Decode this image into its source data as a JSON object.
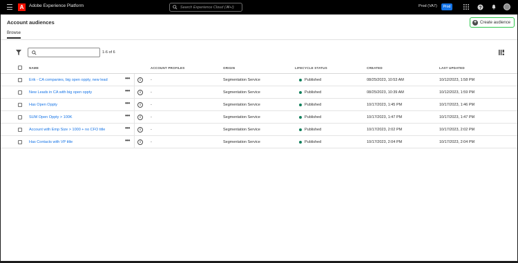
{
  "topbar": {
    "app_title": "Adobe Experience Platform",
    "logo_letter": "A",
    "search_placeholder": "Search Experience Cloud (⌘+/)",
    "org": "Prod (VA7)",
    "sandbox_badge": "Prod",
    "icons": [
      "menu-icon",
      "search-icon",
      "apps-grid-icon",
      "help-icon",
      "bell-icon",
      "avatar"
    ]
  },
  "page": {
    "title": "Account audiences",
    "create_button": "Create audience",
    "tab": "Browse",
    "result_count": "1-6 of 6"
  },
  "table": {
    "headers": [
      "NAME",
      "ACCOUNT PROFILES",
      "ORIGIN",
      "LIFECYCLE STATUS",
      "CREATED",
      "LAST UPDATED"
    ],
    "rows": [
      {
        "name": "Erik - CA companies, big open oppty, new lead",
        "profiles": "-",
        "origin": "Segmentation Service",
        "status": "Published",
        "created": "08/25/2023, 10:53 AM",
        "updated": "10/12/2023, 1:58 PM"
      },
      {
        "name": "New Leads in CA with big open oppty",
        "profiles": "-",
        "origin": "Segmentation Service",
        "status": "Published",
        "created": "08/25/2023, 10:39 AM",
        "updated": "10/12/2023, 1:59 PM"
      },
      {
        "name": "Has Open Oppty",
        "profiles": "-",
        "origin": "Segmentation Service",
        "status": "Published",
        "created": "10/17/2023, 1:45 PM",
        "updated": "10/17/2023, 1:46 PM"
      },
      {
        "name": "SUM Open Oppty > 100K",
        "profiles": "-",
        "origin": "Segmentation Service",
        "status": "Published",
        "created": "10/17/2023, 1:47 PM",
        "updated": "10/17/2023, 1:47 PM"
      },
      {
        "name": "Account with Emp Size > 1000 + no CFO title",
        "profiles": "-",
        "origin": "Segmentation Service",
        "status": "Published",
        "created": "10/17/2023, 2:02 PM",
        "updated": "10/17/2023, 2:02 PM"
      },
      {
        "name": "Has Contacts with VP title",
        "profiles": "-",
        "origin": "Segmentation Service",
        "status": "Published",
        "created": "10/17/2023, 2:04 PM",
        "updated": "10/17/2023, 2:04 PM"
      }
    ],
    "more_glyph": "•••",
    "info_glyph": "i"
  },
  "colors": {
    "accent": "#1473e6",
    "published": "#12805c",
    "create_highlight": "#2dc64c",
    "brand_red": "#fa0f00"
  }
}
